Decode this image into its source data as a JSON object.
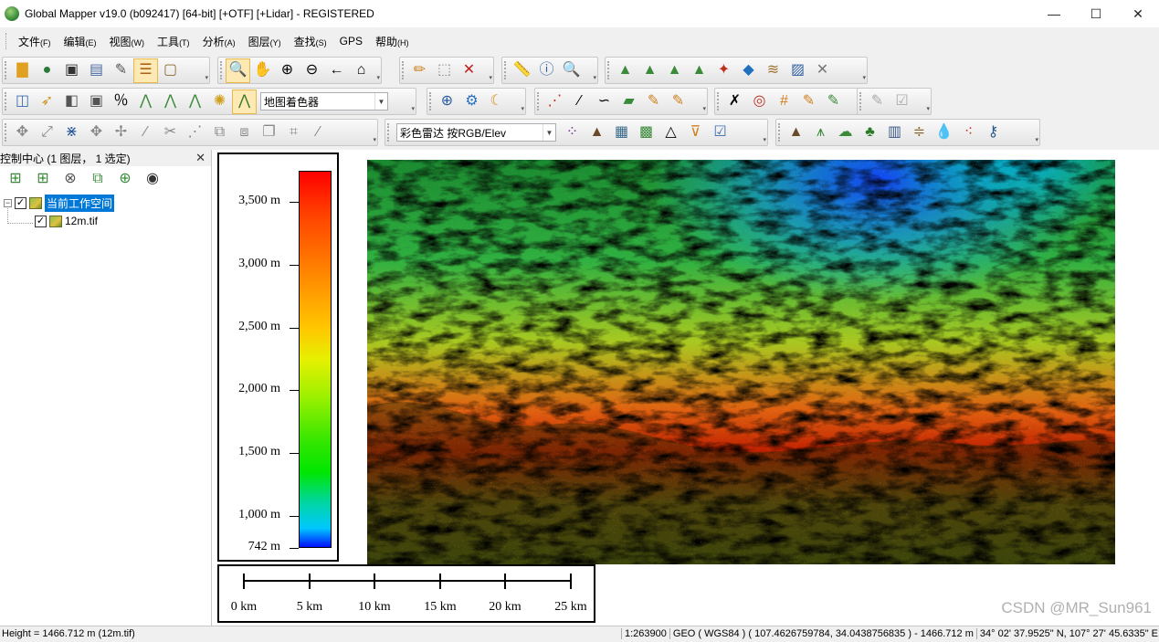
{
  "window": {
    "title": "Global Mapper v19.0 (b092417) [64-bit] [+OTF] [+Lidar] - REGISTERED",
    "controls": [
      "—",
      "☐",
      "✕"
    ]
  },
  "menu": [
    {
      "label": "文件",
      "key": "(F)"
    },
    {
      "label": "编辑",
      "key": "(E)"
    },
    {
      "label": "视图",
      "key": "(W)"
    },
    {
      "label": "工具",
      "key": "(T)"
    },
    {
      "label": "分析",
      "key": "(A)"
    },
    {
      "label": "图层",
      "key": "(Y)"
    },
    {
      "label": "查找",
      "key": "(S)"
    },
    {
      "label": "GPS",
      "key": ""
    },
    {
      "label": "帮助",
      "key": "(H)"
    }
  ],
  "toolbar": {
    "shader_select": "地图着色器",
    "color_mode_select": "彩色雷达 按RGB/Elev"
  },
  "control_center": {
    "title": "控制中心 (1 图层， 1 选定)",
    "close": "✕",
    "workspace_label": "当前工作空间",
    "layer_label": "12m.tif"
  },
  "legend": {
    "labels": [
      "3,500 m",
      "3,000 m",
      "2,500 m",
      "2,000 m",
      "1,500 m",
      "1,000 m",
      "742 m"
    ],
    "elevations": [
      3500,
      3000,
      2500,
      2000,
      1500,
      1000,
      742
    ],
    "min": 742,
    "max": 3750
  },
  "scale": {
    "labels": [
      "0 km",
      "5 km",
      "10 km",
      "15 km",
      "20 km",
      "25 km"
    ]
  },
  "status": {
    "left": "Height = 1466.712 m (12m.tif)",
    "scale": "1:263900",
    "coords": "GEO ( WGS84 ) ( 107.4626759784, 34.0438756835 ) - 1466.712 m",
    "dms": "34° 02' 37.9525\" N, 107° 27' 45.6335\" E"
  },
  "watermark": "CSDN @MR_Sun961"
}
